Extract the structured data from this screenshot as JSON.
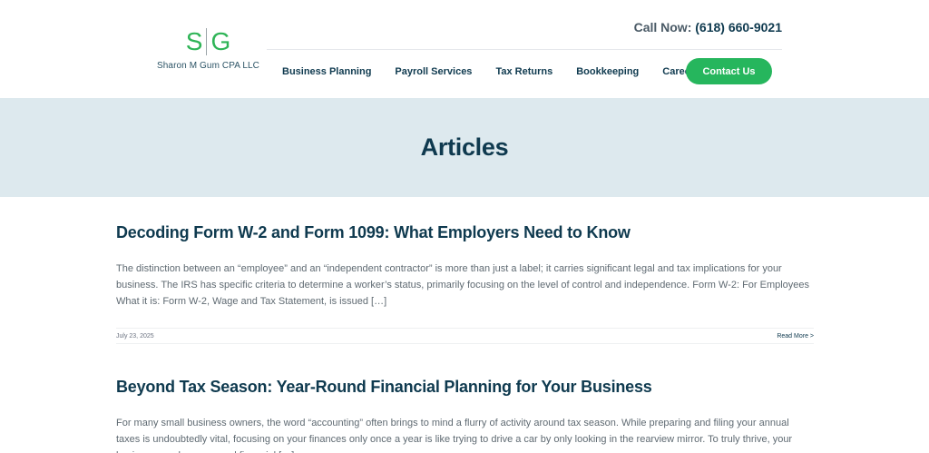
{
  "brand": {
    "logo_left": "S",
    "logo_right": "G",
    "name": "Sharon M Gum CPA LLC"
  },
  "header": {
    "call_label": "Call Now:",
    "phone": "(618) 660-9021"
  },
  "nav": {
    "items": [
      {
        "label": "Business Planning"
      },
      {
        "label": "Payroll Services"
      },
      {
        "label": "Tax Returns"
      },
      {
        "label": "Bookkeeping"
      },
      {
        "label": "Careers"
      }
    ],
    "cta": "Contact Us"
  },
  "banner": {
    "title": "Articles"
  },
  "articles": [
    {
      "title": "Decoding Form W-2 and Form 1099: What Employers Need to Know",
      "excerpt": "The distinction between an “employee” and an “independent contractor” is more than just a label; it carries significant legal and tax implications for your business. The IRS has specific criteria to determine a worker’s status, primarily focusing on the level of control and independence. Form W-2: For Employees What it is: Form W-2, Wage and Tax Statement, is issued […]",
      "date": "July 23, 2025",
      "read_more": "Read More >"
    },
    {
      "title": "Beyond Tax Season: Year-Round Financial Planning for Your Business",
      "excerpt": "For many small business owners, the word “accounting” often brings to mind a flurry of activity around tax season. While preparing and filing your annual taxes is undoubtedly vital, focusing on your finances only once a year is like trying to drive a car by only looking in the rearview mirror. To truly thrive, your business needs year-round financial […]"
    }
  ],
  "colors": {
    "brand_green": "#26b65d",
    "navy": "#0f3a4f",
    "banner_bg": "#dde9ee"
  }
}
